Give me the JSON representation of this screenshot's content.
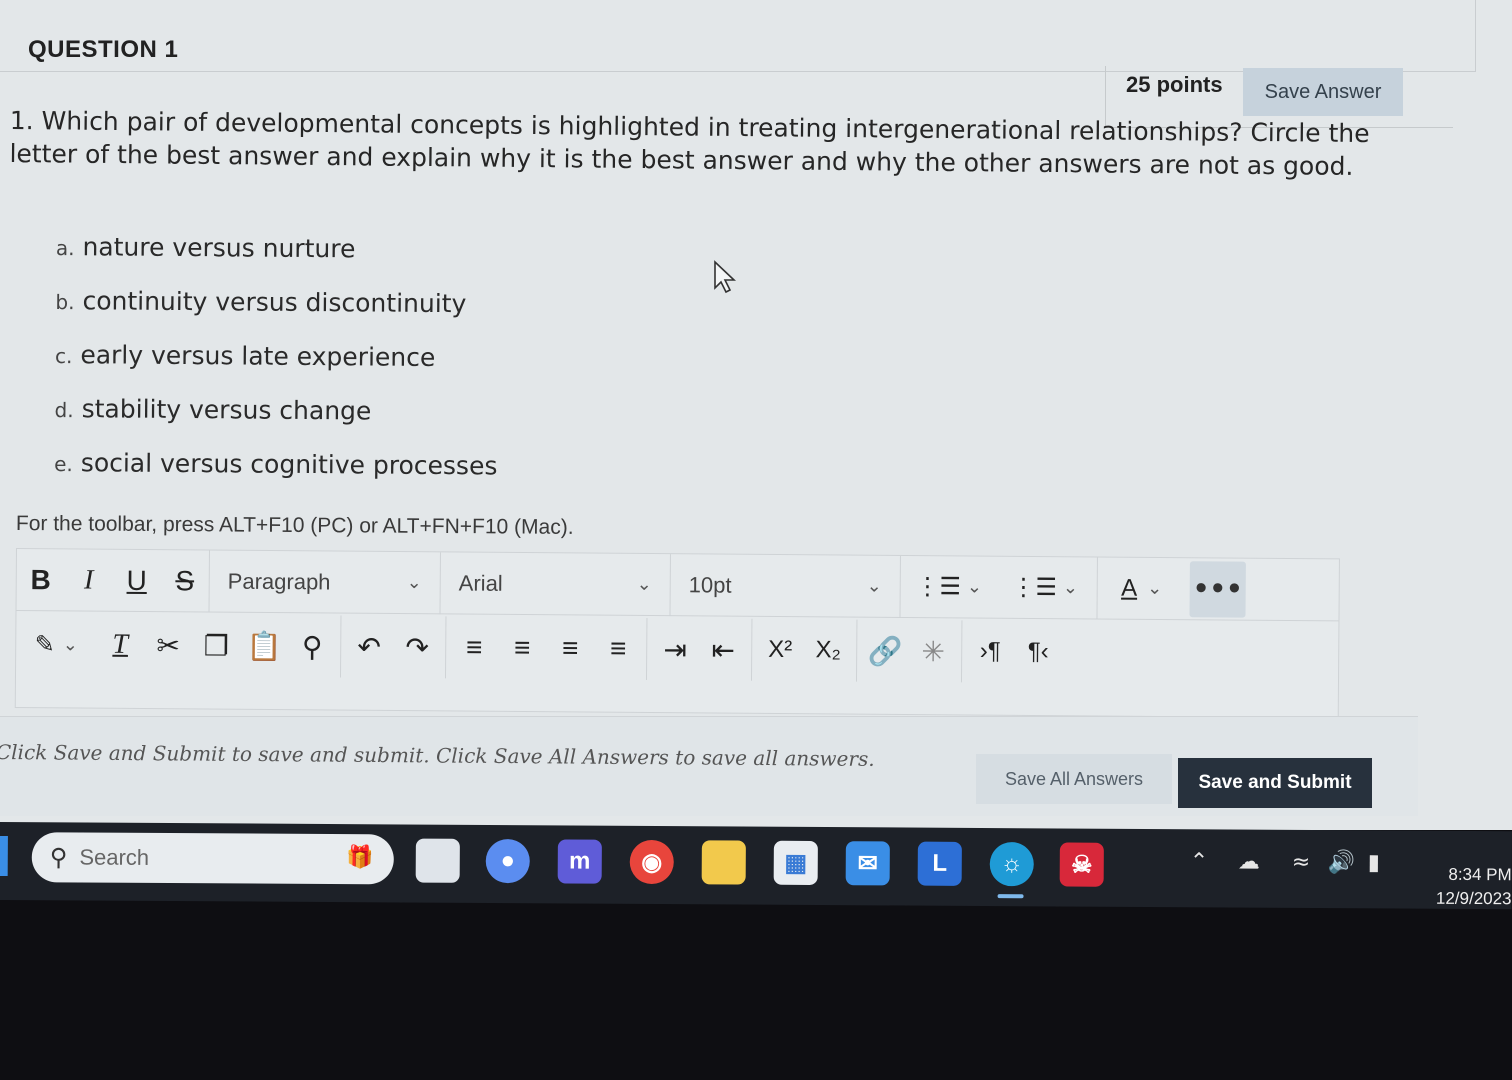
{
  "question": {
    "title": "QUESTION 1",
    "points": "25 points",
    "save_answer_label": "Save Answer",
    "text": "1.  Which pair of developmental concepts is highlighted in treating intergenerational relationships? Circle the letter of the best answer and explain why it is the best answer and why the other answers are not as good.",
    "options": [
      {
        "letter": "a.",
        "text": "nature versus nurture"
      },
      {
        "letter": "b.",
        "text": "continuity versus discontinuity"
      },
      {
        "letter": "c.",
        "text": "early versus late experience"
      },
      {
        "letter": "d.",
        "text": "stability versus change"
      },
      {
        "letter": "e.",
        "text": "social versus cognitive processes"
      }
    ]
  },
  "editor": {
    "toolbar_hint": "For the toolbar, press ALT+F10 (PC) or ALT+FN+F10 (Mac).",
    "block_format": "Paragraph",
    "font_family": "Arial",
    "font_size": "10pt",
    "bold_label": "B",
    "italic_label": "I",
    "underline_label": "U",
    "strike_label": "S",
    "text_color_label": "A",
    "more_label": "•••",
    "superscript_label": "X²",
    "subscript_label": "X₂",
    "ltr_label": "›¶",
    "rtl_label": "¶‹"
  },
  "footer": {
    "note": "Click Save and Submit to save and submit. Click Save All Answers to save all answers.",
    "save_all_label": "Save All Answers",
    "save_submit_label": "Save and Submit"
  },
  "taskbar": {
    "search_placeholder": "Search",
    "time": "8:34 PM",
    "date": "12/9/2023",
    "icons": [
      "task-view-icon",
      "chat-icon",
      "m-app-icon",
      "chrome-icon",
      "file-explorer-icon",
      "store-icon",
      "mail-icon",
      "l-app-icon",
      "edge-icon",
      "mcafee-icon"
    ],
    "l_app_label": "L",
    "m_app_label": "m"
  },
  "colors": {
    "page_bg": "#e3e7e9",
    "save_answer_bg": "#c6d2dc",
    "submit_bg": "#27313d",
    "taskbar_bg": "#1d2128"
  }
}
